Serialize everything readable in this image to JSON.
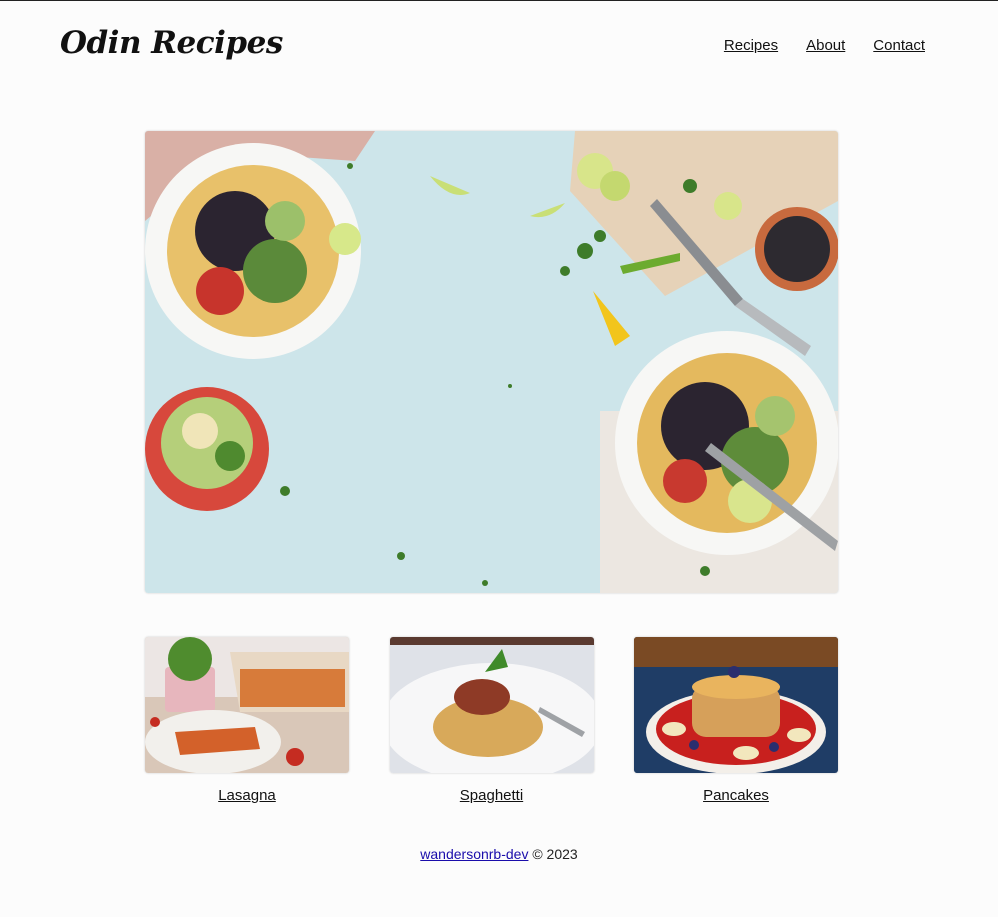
{
  "header": {
    "logo_text": "Odin Recipes",
    "nav": [
      {
        "label": "Recipes"
      },
      {
        "label": "About"
      },
      {
        "label": "Contact"
      }
    ]
  },
  "hero": {
    "image_icon": "food-table-photo"
  },
  "recipes": [
    {
      "label": "Lasagna",
      "image_icon": "lasagna-photo"
    },
    {
      "label": "Spaghetti",
      "image_icon": "spaghetti-photo"
    },
    {
      "label": "Pancakes",
      "image_icon": "pancakes-photo"
    }
  ],
  "footer": {
    "author_link": "wandersonrb-dev",
    "copyright": "© 2023"
  },
  "colors": {
    "background": "#fcfcfc",
    "link": "#1a0dab",
    "hero_surface": "#cfe6ea"
  }
}
